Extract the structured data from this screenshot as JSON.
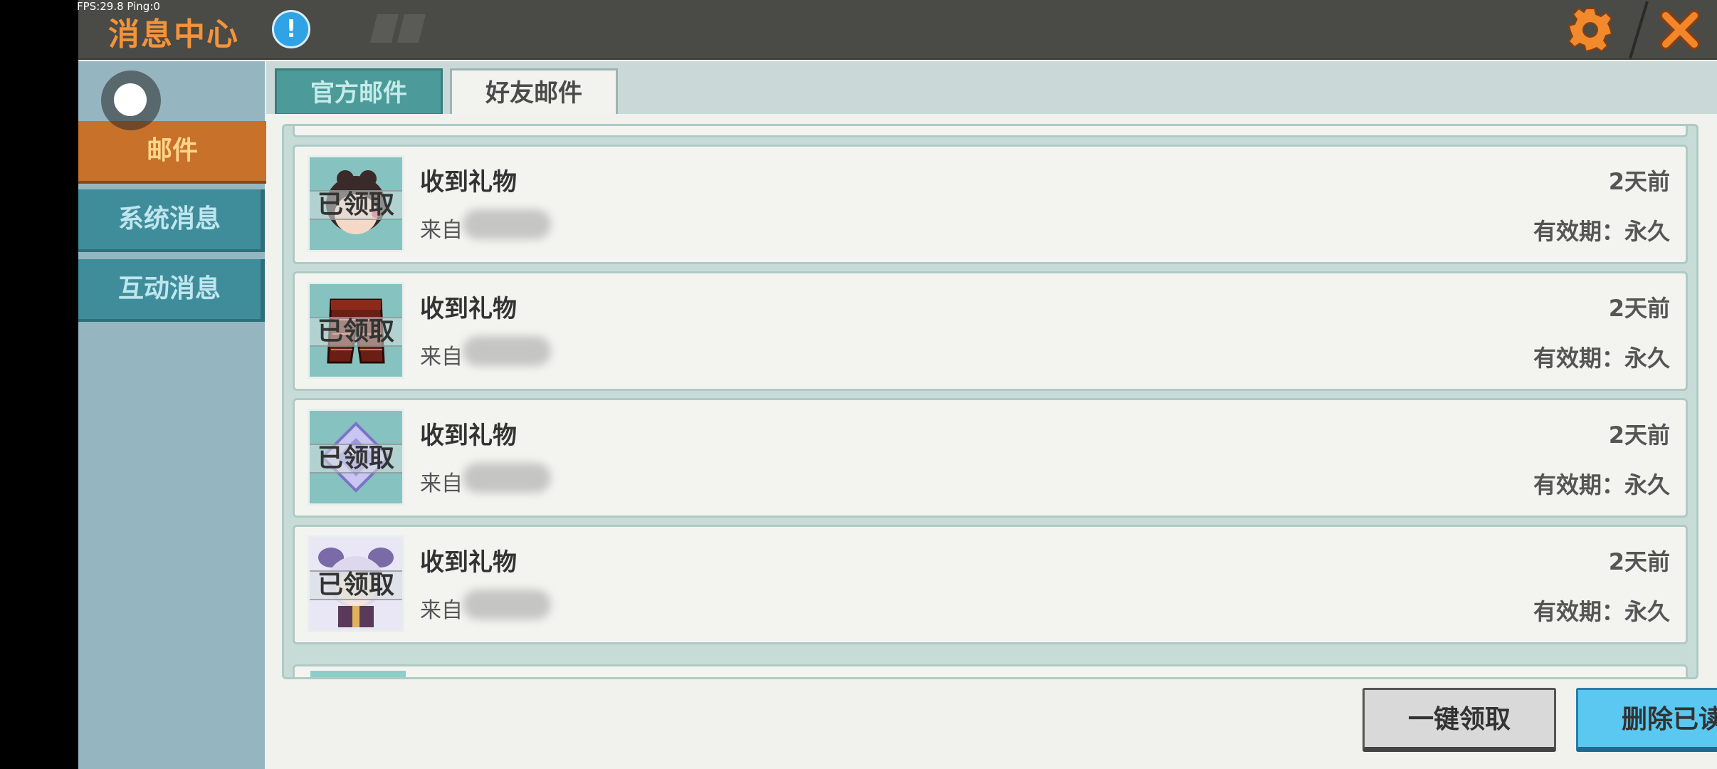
{
  "debug": {
    "stats": "FPS:29.8  Ping:0"
  },
  "header": {
    "title": "消息中心",
    "info_symbol": "!",
    "accent_color": "#f4933a"
  },
  "sidebar": {
    "items": [
      {
        "label": "邮件",
        "active": true
      },
      {
        "label": "系统消息",
        "active": false
      },
      {
        "label": "互动消息",
        "active": false
      }
    ]
  },
  "tabs": [
    {
      "label": "官方邮件",
      "active": false
    },
    {
      "label": "好友邮件",
      "active": true
    }
  ],
  "mail_items": [
    {
      "title": "收到礼物",
      "from_prefix": "来自",
      "time": "2天前",
      "expiry": "有效期：永久",
      "status": "已领取",
      "thumb": "character-head"
    },
    {
      "title": "收到礼物",
      "from_prefix": "来自",
      "time": "2天前",
      "expiry": "有效期：永久",
      "status": "已领取",
      "thumb": "pants"
    },
    {
      "title": "收到礼物",
      "from_prefix": "来自",
      "time": "2天前",
      "expiry": "有效期：永久",
      "status": "已领取",
      "thumb": "gem"
    },
    {
      "title": "收到礼物",
      "from_prefix": "来自",
      "time": "2天前",
      "expiry": "有效期：永久",
      "status": "已领取",
      "thumb": "character-bunny"
    }
  ],
  "actions": {
    "claim_all": "一键领取",
    "delete_read": "删除已读"
  }
}
